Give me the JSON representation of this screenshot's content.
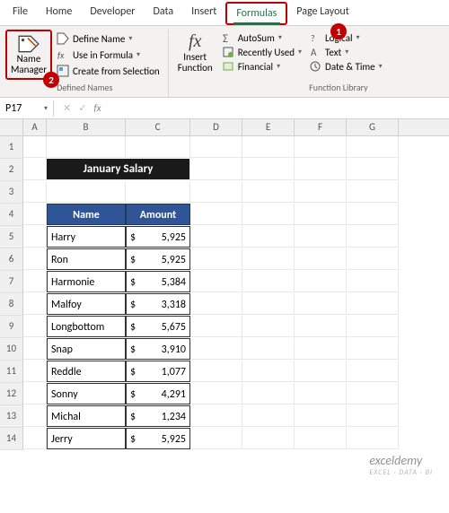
{
  "tabs": [
    "File",
    "Home",
    "Developer",
    "Data",
    "Insert",
    "Formulas",
    "Page Layout"
  ],
  "active_tab": "Formulas",
  "ribbon": {
    "name_manager": {
      "label1": "Name",
      "label2": "Manager"
    },
    "defined_names": {
      "define_name": "Define Name",
      "use_in_formula": "Use in Formula",
      "create_from_selection": "Create from Selection",
      "group_label": "Defined Names"
    },
    "insert_function": {
      "symbol": "fx",
      "label1": "Insert",
      "label2": "Function"
    },
    "function_library": {
      "autosum": "AutoSum",
      "recently_used": "Recently Used",
      "financial": "Financial",
      "logical": "Logical",
      "text": "Text",
      "date_time": "Date & Time",
      "group_label": "Function Library"
    }
  },
  "callouts": {
    "c1": "1",
    "c2": "2"
  },
  "formula_bar": {
    "name_box": "P17",
    "fx": "fx"
  },
  "columns": [
    "A",
    "B",
    "C",
    "D",
    "E",
    "F",
    "G"
  ],
  "sheet_title": "January Salary",
  "table": {
    "headers": {
      "name": "Name",
      "amount": "Amount"
    },
    "currency": "$",
    "rows": [
      {
        "name": "Harry",
        "amount": "5,925"
      },
      {
        "name": "Ron",
        "amount": "5,925"
      },
      {
        "name": "Harmonie",
        "amount": "5,384"
      },
      {
        "name": "Malfoy",
        "amount": "3,318"
      },
      {
        "name": "Longbottom",
        "amount": "5,675"
      },
      {
        "name": "Snap",
        "amount": "3,910"
      },
      {
        "name": "Reddle",
        "amount": "1,077"
      },
      {
        "name": "Sonny",
        "amount": "4,291"
      },
      {
        "name": "Michal",
        "amount": "1,234"
      },
      {
        "name": "Jerry",
        "amount": "5,925"
      }
    ]
  },
  "row_numbers": [
    "1",
    "2",
    "3",
    "4",
    "5",
    "6",
    "7",
    "8",
    "9",
    "10",
    "11",
    "12",
    "13",
    "14"
  ],
  "watermark": {
    "main": "exceldemy",
    "sub": "EXCEL · DATA · BI"
  }
}
